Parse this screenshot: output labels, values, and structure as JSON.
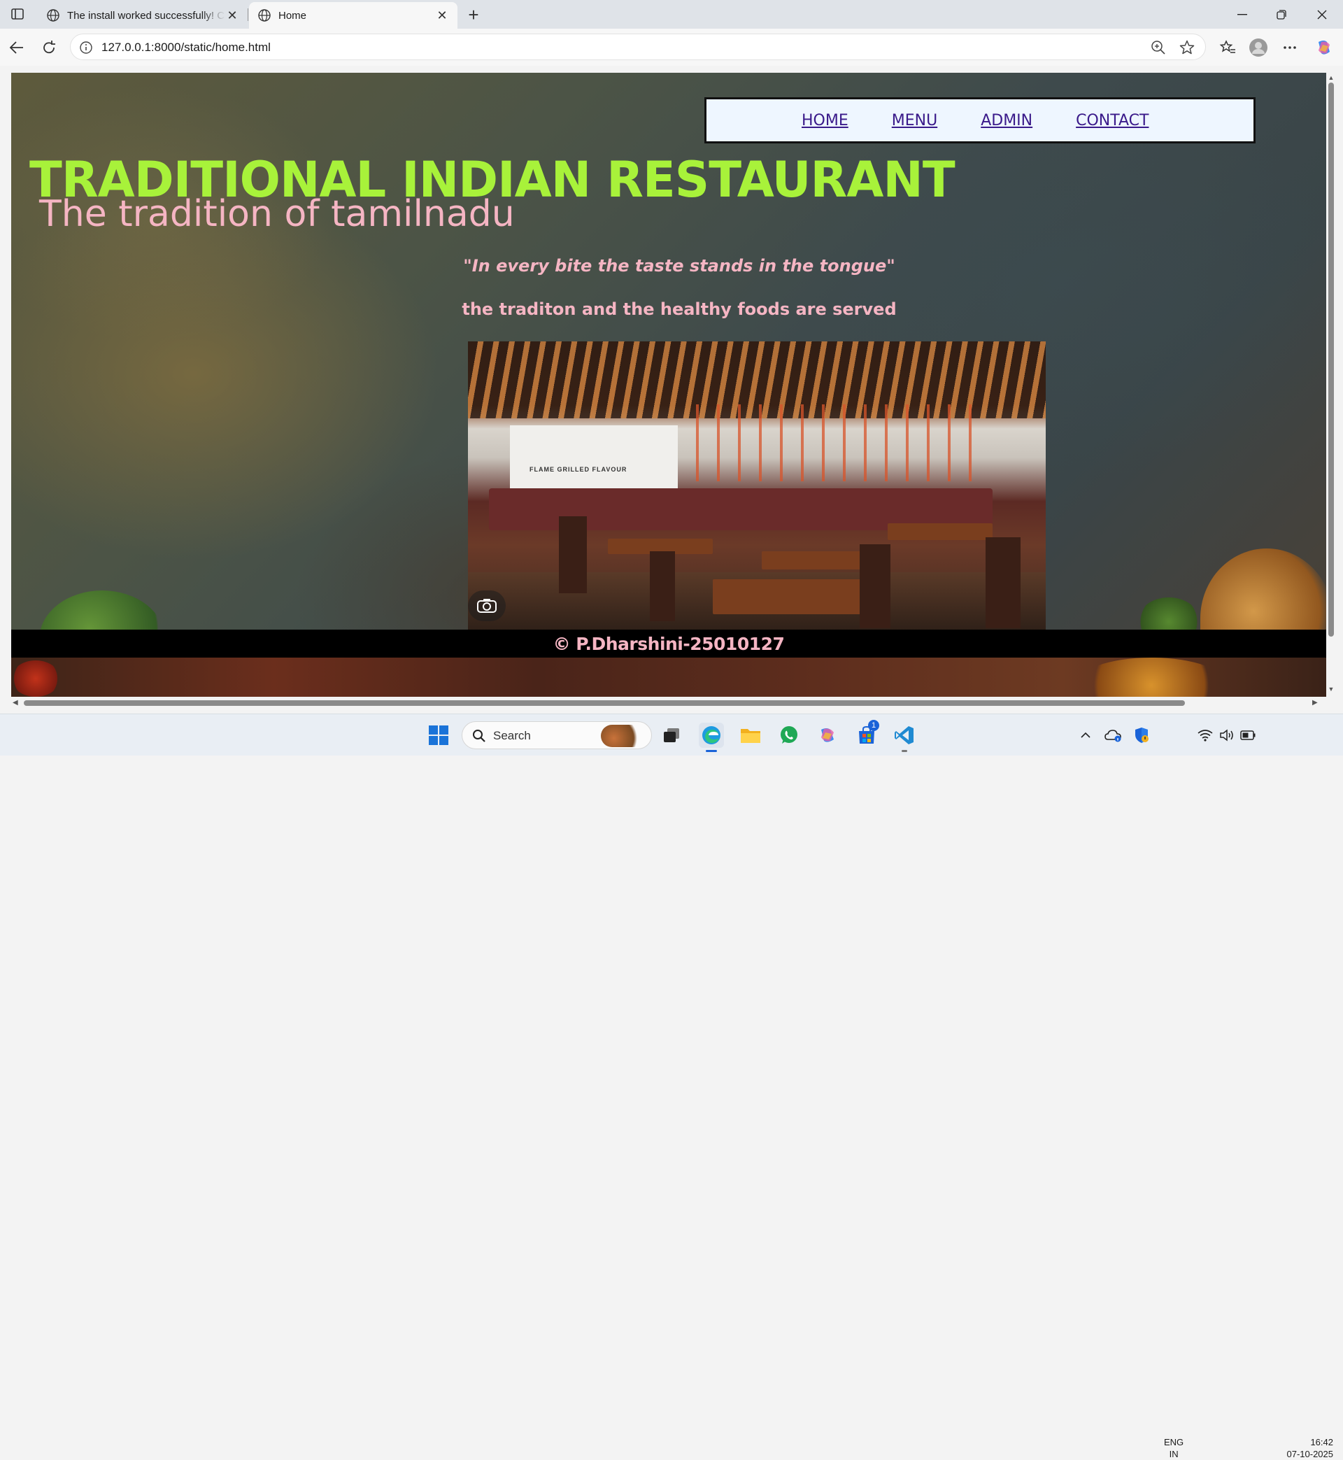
{
  "browser": {
    "tabs": [
      {
        "title": "The install worked successfully! Co"
      },
      {
        "title": "Home"
      }
    ],
    "url": "127.0.0.1:8000/static/home.html"
  },
  "page": {
    "nav": [
      "HOME",
      "MENU",
      "ADMIN",
      "CONTACT"
    ],
    "heading": "TRADITIONAL INDIAN RESTAURANT",
    "subheading": "The tradition of tamilnadu",
    "quote": "\"In every bite the taste stands in the tongue\"",
    "tagline": "the traditon and the healthy foods are served",
    "photo_sign": "FLAME   GRILLED   FLAVOUR",
    "footer": "© P.Dharshini-25010127"
  },
  "taskbar": {
    "search_placeholder": "Search",
    "notification_count": "1",
    "lang_line1": "ENG",
    "lang_line2": "IN",
    "time": "16:42",
    "date": "07-10-2025"
  },
  "colors": {
    "heading": "#a8f23a",
    "pink_text": "#f5b5c3",
    "nav_link": "#3a1a8a",
    "nav_bg": "#eef6ff"
  }
}
